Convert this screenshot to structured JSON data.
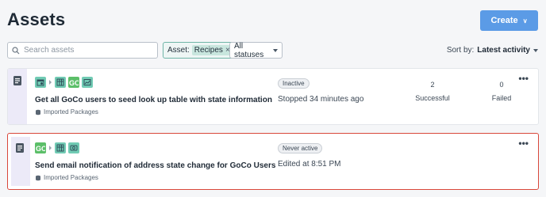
{
  "header": {
    "title": "Assets",
    "create_label": "Create"
  },
  "filters": {
    "search_placeholder": "Search assets",
    "asset_prefix": "Asset:",
    "asset_chip": "Recipes",
    "status_label": "All statuses",
    "sort_prefix": "Sort by:",
    "sort_value": "Latest activity"
  },
  "recipes": [
    {
      "name": "Get all GoCo users to seed look up table with state information",
      "package": "Imported Packages",
      "badge": "Inactive",
      "status_text": "Stopped 34 minutes ago",
      "successful_count": "2",
      "successful_label": "Successful",
      "failed_count": "0",
      "failed_label": "Failed",
      "icons": [
        "scheduler-icon",
        "table-icon",
        "goco-icon",
        "report-icon"
      ]
    },
    {
      "name": "Send email notification of address state change for GoCo Users",
      "package": "Imported Packages",
      "badge": "Never active",
      "status_text": "Edited at 8:51 PM",
      "icons": [
        "goco-icon",
        "table-icon",
        "email-icon"
      ]
    }
  ],
  "colors": {
    "accent": "#5b9be6",
    "selected_border": "#d9473a",
    "goco_green": "#5cbf69",
    "teal": "#71cbb4"
  }
}
